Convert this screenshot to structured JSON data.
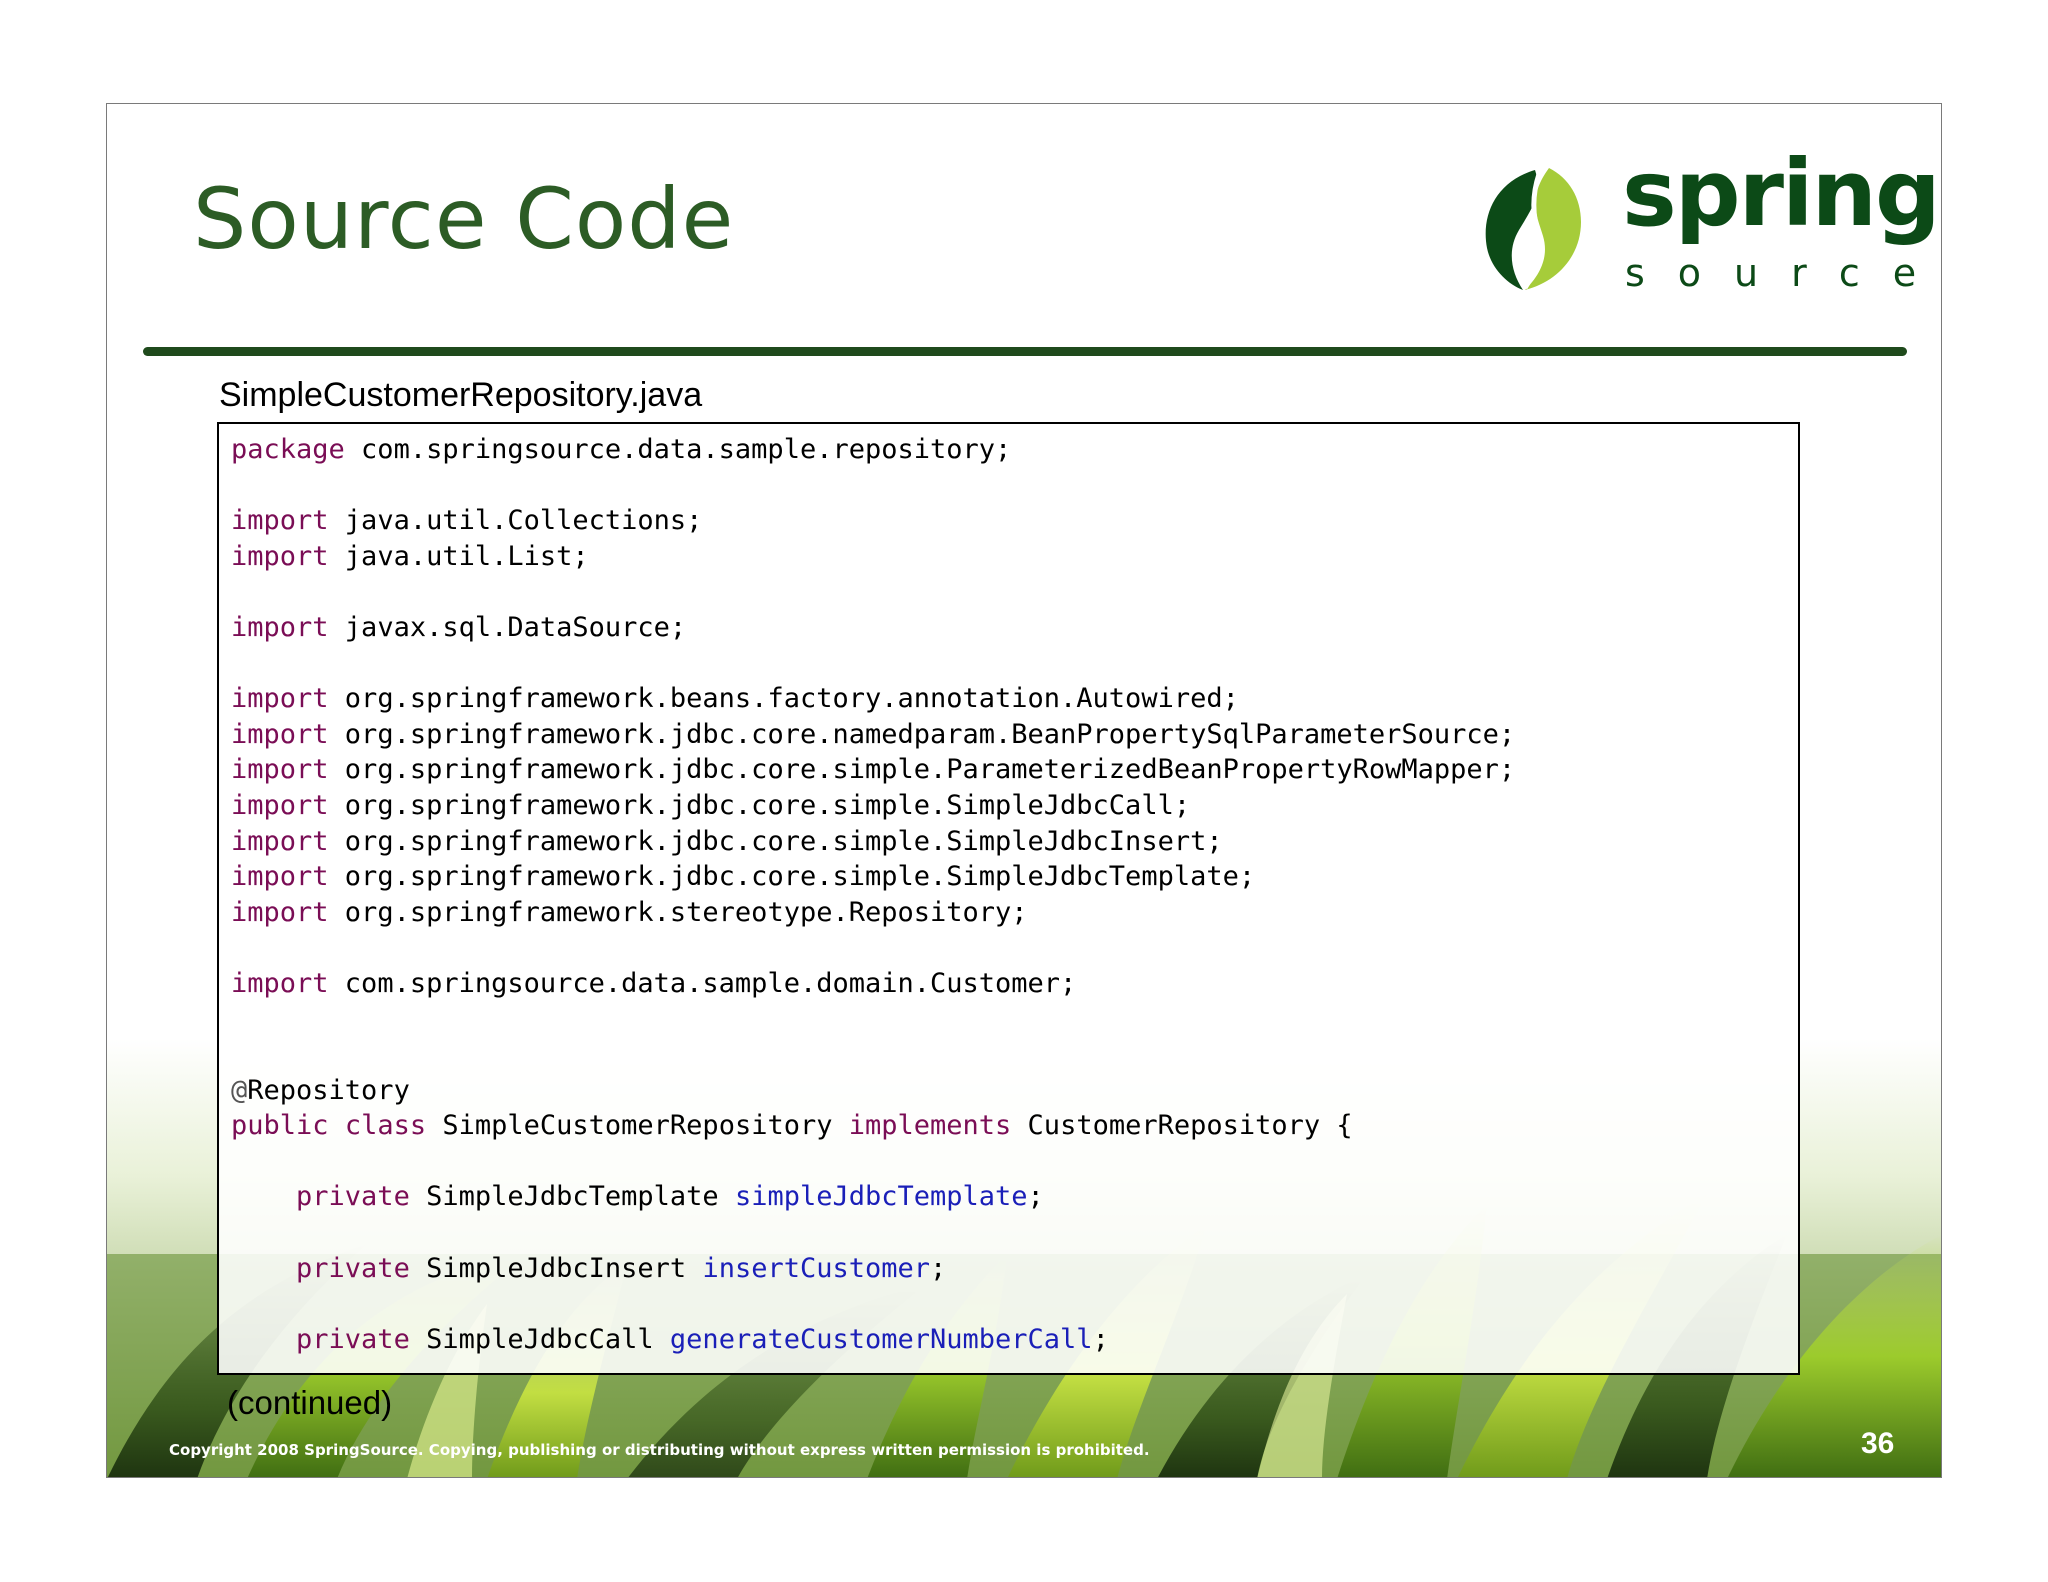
{
  "slide": {
    "title": "Source Code",
    "logo": {
      "word": "spring",
      "sub": "source"
    },
    "file_label": "SimpleCustomerRepository.java",
    "code_lines": [
      [
        {
          "t": "package",
          "c": "kw"
        },
        {
          "t": " com.springsource.data.sample.repository;",
          "c": ""
        }
      ],
      [],
      [
        {
          "t": "import",
          "c": "kw"
        },
        {
          "t": " java.util.Collections;",
          "c": ""
        }
      ],
      [
        {
          "t": "import",
          "c": "kw"
        },
        {
          "t": " java.util.List;",
          "c": ""
        }
      ],
      [],
      [
        {
          "t": "import",
          "c": "kw"
        },
        {
          "t": " javax.sql.DataSource;",
          "c": ""
        }
      ],
      [],
      [
        {
          "t": "import",
          "c": "kw"
        },
        {
          "t": " org.springframework.beans.factory.annotation.Autowired;",
          "c": ""
        }
      ],
      [
        {
          "t": "import",
          "c": "kw"
        },
        {
          "t": " org.springframework.jdbc.core.namedparam.BeanPropertySqlParameterSource;",
          "c": ""
        }
      ],
      [
        {
          "t": "import",
          "c": "kw"
        },
        {
          "t": " org.springframework.jdbc.core.simple.ParameterizedBeanPropertyRowMapper;",
          "c": ""
        }
      ],
      [
        {
          "t": "import",
          "c": "kw"
        },
        {
          "t": " org.springframework.jdbc.core.simple.SimpleJdbcCall;",
          "c": ""
        }
      ],
      [
        {
          "t": "import",
          "c": "kw"
        },
        {
          "t": " org.springframework.jdbc.core.simple.SimpleJdbcInsert;",
          "c": ""
        }
      ],
      [
        {
          "t": "import",
          "c": "kw"
        },
        {
          "t": " org.springframework.jdbc.core.simple.SimpleJdbcTemplate;",
          "c": ""
        }
      ],
      [
        {
          "t": "import",
          "c": "kw"
        },
        {
          "t": " org.springframework.stereotype.Repository;",
          "c": ""
        }
      ],
      [],
      [
        {
          "t": "import",
          "c": "kw"
        },
        {
          "t": " com.springsource.data.sample.domain.Customer;",
          "c": ""
        }
      ],
      [],
      [],
      [
        {
          "t": "@",
          "c": "ann"
        },
        {
          "t": "Repository",
          "c": ""
        }
      ],
      [
        {
          "t": "public",
          "c": "kw"
        },
        {
          "t": " ",
          "c": ""
        },
        {
          "t": "class",
          "c": "kw"
        },
        {
          "t": " SimpleCustomerRepository ",
          "c": ""
        },
        {
          "t": "implements",
          "c": "kw"
        },
        {
          "t": " CustomerRepository {",
          "c": ""
        }
      ],
      [],
      [
        {
          "t": "    ",
          "c": ""
        },
        {
          "t": "private",
          "c": "kw"
        },
        {
          "t": " SimpleJdbcTemplate ",
          "c": ""
        },
        {
          "t": "simpleJdbcTemplate",
          "c": "fld"
        },
        {
          "t": ";",
          "c": ""
        }
      ],
      [],
      [
        {
          "t": "    ",
          "c": ""
        },
        {
          "t": "private",
          "c": "kw"
        },
        {
          "t": " SimpleJdbcInsert ",
          "c": ""
        },
        {
          "t": "insertCustomer",
          "c": "fld"
        },
        {
          "t": ";",
          "c": ""
        }
      ],
      [],
      [
        {
          "t": "    ",
          "c": ""
        },
        {
          "t": "private",
          "c": "kw"
        },
        {
          "t": " SimpleJdbcCall ",
          "c": ""
        },
        {
          "t": "generateCustomerNumberCall",
          "c": "fld"
        },
        {
          "t": ";",
          "c": ""
        }
      ]
    ],
    "continued": "(continued)",
    "copyright": "Copyright 2008 SpringSource.  Copying, publishing or distributing without express written permission is prohibited.",
    "page_number": "36"
  },
  "colors": {
    "title": "#2c5c25",
    "divider": "#1f4a1c",
    "keyword": "#7a0d55",
    "field": "#1a1fb8",
    "logo_dark": "#0c4a17",
    "logo_light": "#a6cc3a"
  }
}
